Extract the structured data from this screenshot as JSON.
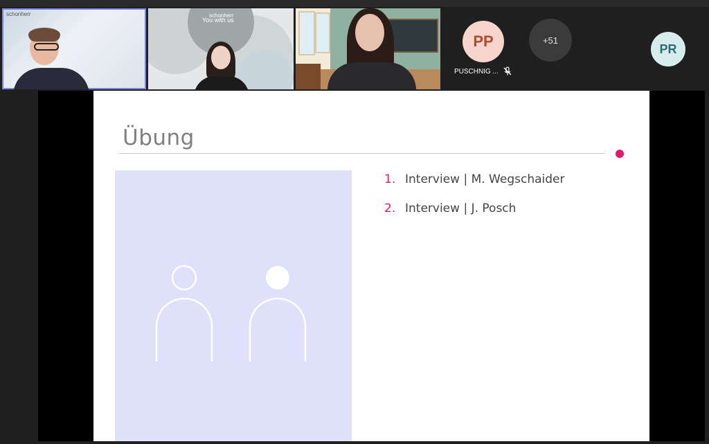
{
  "participants": {
    "tiles": [
      {
        "logo": "schonherr"
      },
      {
        "logo": "schonherr",
        "slogan": "You with us"
      },
      {}
    ],
    "avatars": {
      "pp": {
        "initials": "PP",
        "name": "PUSCHNIG ...",
        "bg": "#f6d5cc",
        "fg": "#b24a2f"
      },
      "more": {
        "label": "+51"
      },
      "pr": {
        "initials": "PR",
        "bg": "#d7ecec",
        "fg": "#2b6f74"
      }
    }
  },
  "slide": {
    "title": "Übung",
    "accent_color": "#e5176e",
    "illustration_bg": "#dfe1fb",
    "items": [
      {
        "num": "1.",
        "text": "Interview | M. Wegschaider"
      },
      {
        "num": "2.",
        "text": "Interview | J. Posch"
      }
    ]
  }
}
